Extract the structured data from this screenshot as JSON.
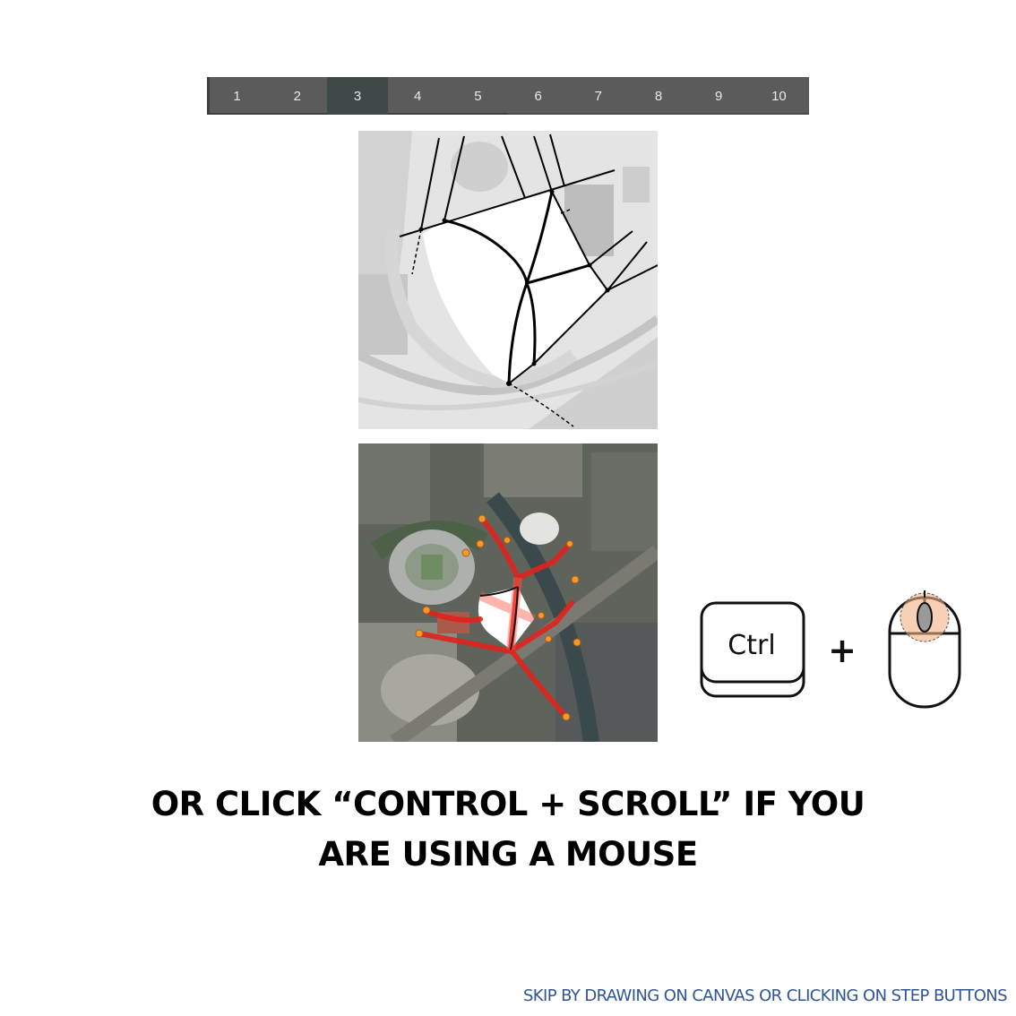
{
  "steps": {
    "labels": [
      "1",
      "2",
      "3",
      "4",
      "5",
      "6",
      "7",
      "8",
      "9",
      "10"
    ],
    "active_index": 2,
    "progress_fraction": 0.5
  },
  "ctrl_key": {
    "label": "Ctrl"
  },
  "plus": {
    "label": "+"
  },
  "instruction": {
    "line1": "OR CLICK “CONTROL + SCROLL” IF YOU",
    "line2": "ARE USING A MOUSE"
  },
  "skip": {
    "label": "SKIP BY DRAWING ON CANVAS OR CLICKING ON STEP BUTTONS"
  },
  "colors": {
    "step_bar": "#5b5b5b",
    "step_active": "#3e4a4a",
    "route_red": "#e0231c",
    "marker_orange": "#f39a2a",
    "link_blue": "#2f5496"
  },
  "icons": {
    "keyboard": "ctrl-key-icon",
    "mouse": "mouse-scroll-icon"
  }
}
